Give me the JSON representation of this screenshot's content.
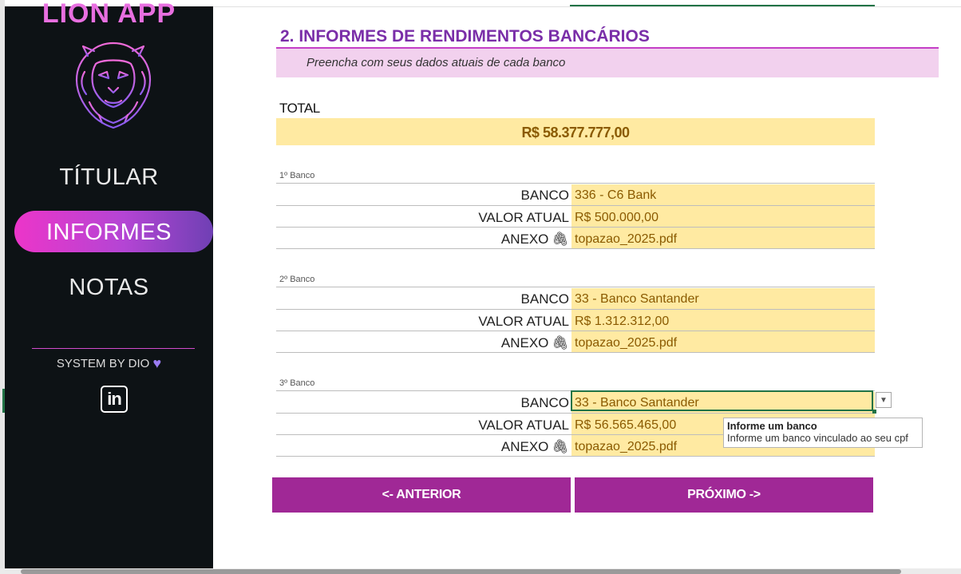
{
  "sidebar": {
    "app_title_1": "LION",
    "app_title_2": "APP",
    "nav": {
      "titular": "TÍTULAR",
      "informes": "INFORMES",
      "notas": "NOTAS"
    },
    "system_by": "SYSTEM BY DIO",
    "linkedin_text": "in"
  },
  "section": {
    "title": "2. INFORMES DE RENDIMENTOS BANCÁRIOS",
    "subtitle": "Preencha com seus dados atuais de cada banco"
  },
  "total": {
    "label": "TOTAL",
    "value": "R$ 58.377.777,00"
  },
  "field_labels": {
    "banco": "BANCO",
    "valor_atual": "VALOR ATUAL",
    "anexo": "ANEXO"
  },
  "banks": [
    {
      "caption": "1º Banco",
      "banco": "336 - C6 Bank",
      "valor": "R$ 500.000,00",
      "anexo": "topazao_2025.pdf"
    },
    {
      "caption": "2º Banco",
      "banco": "33 - Banco Santander",
      "valor": "R$ 1.312.312,00",
      "anexo": "topazao_2025.pdf"
    },
    {
      "caption": "3º Banco",
      "banco": "33 - Banco Santander",
      "valor": "R$ 56.565.465,00",
      "anexo": "topazao_2025.pdf"
    }
  ],
  "tooltip": {
    "title": "Informe um banco",
    "body": "Informe um banco vinculado ao seu cpf"
  },
  "buttons": {
    "prev": "<- ANTERIOR",
    "next": "PRÓXIMO ->"
  },
  "colors": {
    "sidebar_bg": "#0d1215",
    "accent_purple": "#7a2ea8",
    "button_bg": "#a02896",
    "input_fill": "#ffeaa2",
    "input_text": "#8a5a00"
  }
}
